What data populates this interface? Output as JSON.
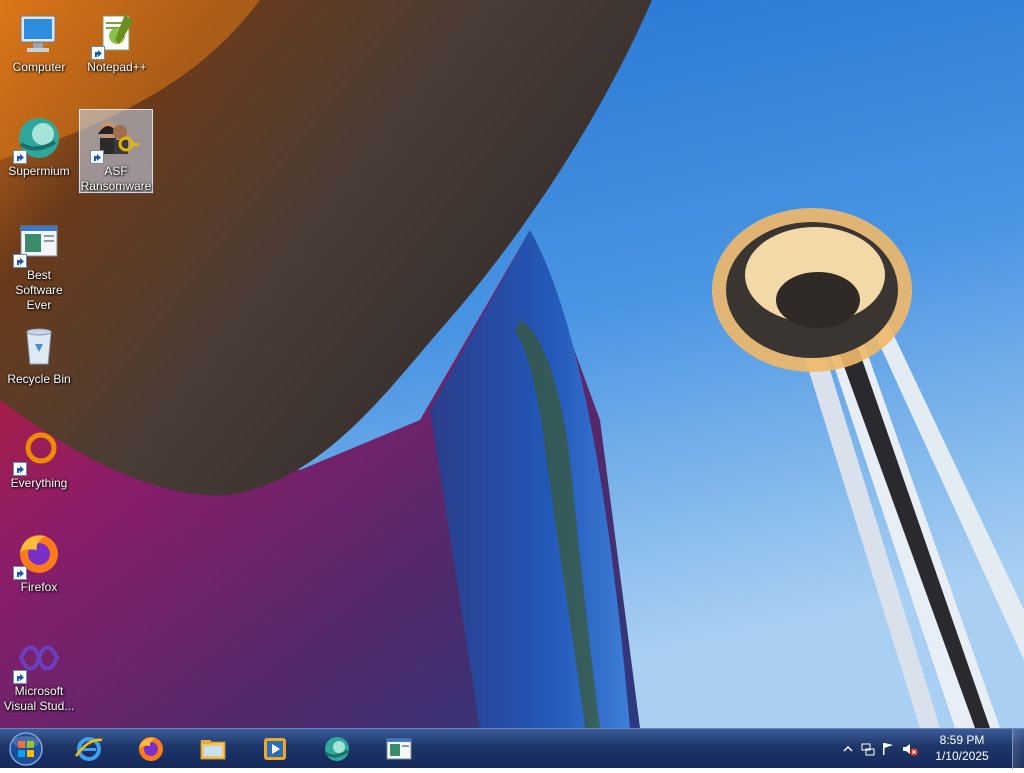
{
  "desktop": {
    "icons": [
      {
        "label": "Computer",
        "icon": "computer-icon",
        "shortcut": false
      },
      {
        "label": "Notepad++",
        "icon": "notepad-plus-plus-icon",
        "shortcut": true
      },
      {
        "label": "Supermium",
        "icon": "supermium-icon",
        "shortcut": true
      },
      {
        "label": "ASF Ransomware",
        "icon": "asf-ransomware-icon",
        "shortcut": true,
        "selected": true
      },
      {
        "label": "Best Software Ever",
        "icon": "best-software-icon",
        "shortcut": true
      },
      {
        "label": "Recycle Bin",
        "icon": "recycle-bin-icon",
        "shortcut": false
      },
      {
        "label": "Everything",
        "icon": "everything-icon",
        "shortcut": true
      },
      {
        "label": "Firefox",
        "icon": "firefox-icon",
        "shortcut": true
      },
      {
        "label": "Microsoft Visual Stud...",
        "icon": "visual-studio-icon",
        "shortcut": true
      }
    ]
  },
  "taskbar": {
    "start_button": "start-orb-icon",
    "pinned": [
      {
        "icon": "internet-explorer-icon"
      },
      {
        "icon": "firefox-icon"
      },
      {
        "icon": "file-explorer-icon"
      },
      {
        "icon": "media-player-icon"
      },
      {
        "icon": "supermium-icon"
      },
      {
        "icon": "best-software-icon"
      }
    ],
    "tray": {
      "icons": [
        "show-hidden-icons-chevron",
        "network-icon",
        "action-center-flag-icon",
        "volume-muted-icon"
      ],
      "time": "8:59 PM",
      "date": "1/10/2025"
    }
  },
  "colors": {
    "taskbar_top": "#3c5c9a",
    "taskbar_bottom": "#14295a",
    "sky": "#3d8be0"
  }
}
